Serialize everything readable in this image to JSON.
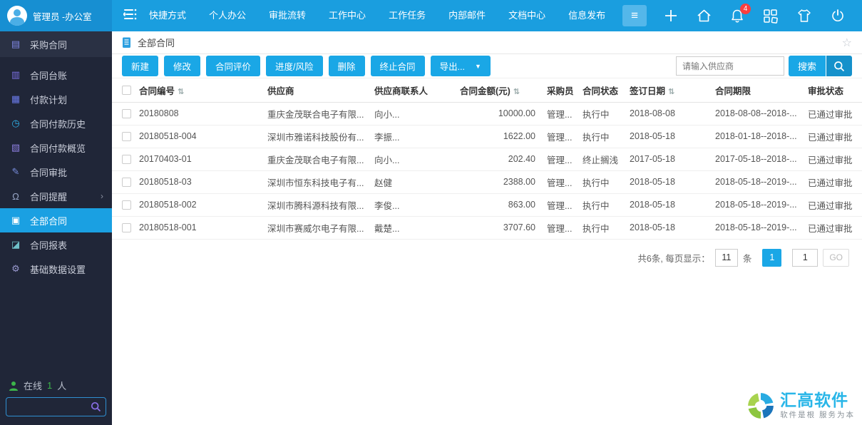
{
  "topbar": {
    "user": "管理员 -办公室",
    "nav": [
      "快捷方式",
      "个人办公",
      "审批流转",
      "工作中心",
      "工作任务",
      "内部邮件",
      "文档中心",
      "信息发布"
    ],
    "badge": "4"
  },
  "sidebar": {
    "items": [
      {
        "label": "采购合同",
        "icon": "purchase-doc",
        "state": "section"
      },
      {
        "label": "合同台账",
        "icon": "ledger",
        "state": ""
      },
      {
        "label": "付款计划",
        "icon": "payment-plan",
        "state": ""
      },
      {
        "label": "合同付款历史",
        "icon": "clock",
        "state": ""
      },
      {
        "label": "合同付款概览",
        "icon": "clipboard",
        "state": ""
      },
      {
        "label": "合同审批",
        "icon": "approval",
        "state": ""
      },
      {
        "label": "合同提醒",
        "icon": "bell",
        "state": "",
        "has_submenu": true
      },
      {
        "label": "全部合同",
        "icon": "briefcase",
        "state": "active"
      },
      {
        "label": "合同报表",
        "icon": "chart",
        "state": ""
      },
      {
        "label": "基础数据设置",
        "icon": "gear",
        "state": ""
      }
    ],
    "online_label": "在线",
    "online_count": "1",
    "online_unit": "人"
  },
  "page": {
    "title": "全部合同"
  },
  "toolbar": {
    "buttons": [
      {
        "label": "新建"
      },
      {
        "label": "修改"
      },
      {
        "label": "合同评价"
      },
      {
        "label": "进度/风险"
      },
      {
        "label": "删除"
      },
      {
        "label": "终止合同"
      },
      {
        "label": "导出...",
        "caret": "▼"
      }
    ],
    "search_placeholder": "请输入供应商",
    "search_label": "搜索"
  },
  "table": {
    "headers": [
      {
        "label": "合同编号",
        "sort": true
      },
      {
        "label": "供应商"
      },
      {
        "label": "供应商联系人"
      },
      {
        "label": "合同金额(元)",
        "sort": true,
        "align": "amount"
      },
      {
        "label": "采购员"
      },
      {
        "label": "合同状态"
      },
      {
        "label": "签订日期",
        "sort": true
      },
      {
        "label": "合同期限"
      },
      {
        "label": "审批状态"
      }
    ],
    "rows": [
      {
        "id": "20180808",
        "supplier": "重庆金茂联合电子有限...",
        "contact": "向小...",
        "amount": "10000.00",
        "buyer": "管理...",
        "status": "执行中",
        "sign_date": "2018-08-08",
        "period": "2018-08-08--2018-...",
        "approval": "已通过审批"
      },
      {
        "id": "20180518-004",
        "supplier": "深圳市雅诺科技股份有...",
        "contact": "李振...",
        "amount": "1622.00",
        "buyer": "管理...",
        "status": "执行中",
        "sign_date": "2018-05-18",
        "period": "2018-01-18--2018-...",
        "approval": "已通过审批"
      },
      {
        "id": "20170403-01",
        "supplier": "重庆金茂联合电子有限...",
        "contact": "向小...",
        "amount": "202.40",
        "buyer": "管理...",
        "status": "终止搁浅",
        "sign_date": "2017-05-18",
        "period": "2017-05-18--2018-...",
        "approval": "已通过审批"
      },
      {
        "id": "20180518-03",
        "supplier": "深圳市恒东科技电子有...",
        "contact": "赵健",
        "amount": "2388.00",
        "buyer": "管理...",
        "status": "执行中",
        "sign_date": "2018-05-18",
        "period": "2018-05-18--2019-...",
        "approval": "已通过审批"
      },
      {
        "id": "20180518-002",
        "supplier": "深圳市腾科源科技有限...",
        "contact": "李俊...",
        "amount": "863.00",
        "buyer": "管理...",
        "status": "执行中",
        "sign_date": "2018-05-18",
        "period": "2018-05-18--2019-...",
        "approval": "已通过审批"
      },
      {
        "id": "20180518-001",
        "supplier": "深圳市赛威尔电子有限...",
        "contact": "戴楚...",
        "amount": "3707.60",
        "buyer": "管理...",
        "status": "执行中",
        "sign_date": "2018-05-18",
        "period": "2018-05-18--2019-...",
        "approval": "已通过审批"
      }
    ]
  },
  "pagination": {
    "summary": "共6条, 每页显示：",
    "per_page": "11",
    "unit": "条",
    "current_page": "1",
    "goto_value": "1",
    "go_label": "GO"
  },
  "logo": {
    "name": "汇高软件",
    "tagline": "软件是根 服务为本"
  },
  "colors": {
    "accent": "#1a9edf",
    "sidebar_bg": "#202638",
    "badge": "#fa3e3e",
    "online_green": "#3cb54a"
  }
}
